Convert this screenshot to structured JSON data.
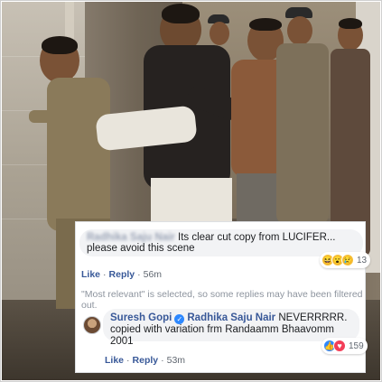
{
  "comment1": {
    "author_blurred": "Radhika Saju Nair",
    "author_visible": "Saju Nair",
    "text": "Its clear cut copy from LUCIFER... please avoid this scene",
    "reactions": {
      "icons": [
        "haha-icon",
        "wow-icon",
        "sad-icon"
      ],
      "count": "13"
    },
    "actions": {
      "like": "Like",
      "reply": "Reply",
      "time": "56m"
    }
  },
  "filter_note": "\"Most relevant\" is selected, so some replies may have been filtered out.",
  "comment2": {
    "author": "Suresh Gopi",
    "mention": "Radhika Saju Nair",
    "text": "NEVERRRRR. copied with variation frm Randaamm Bhaavomm 2001",
    "reactions": {
      "icons": [
        "like-icon",
        "love-icon"
      ],
      "count": "159"
    },
    "actions": {
      "like": "Like",
      "reply": "Reply",
      "time": "53m"
    }
  },
  "colors": {
    "link_blue": "#385898",
    "bubble_bg": "#f2f3f5",
    "meta_gray": "#606770",
    "like_blue": "#2d88ff",
    "love_red": "#f33e58"
  }
}
